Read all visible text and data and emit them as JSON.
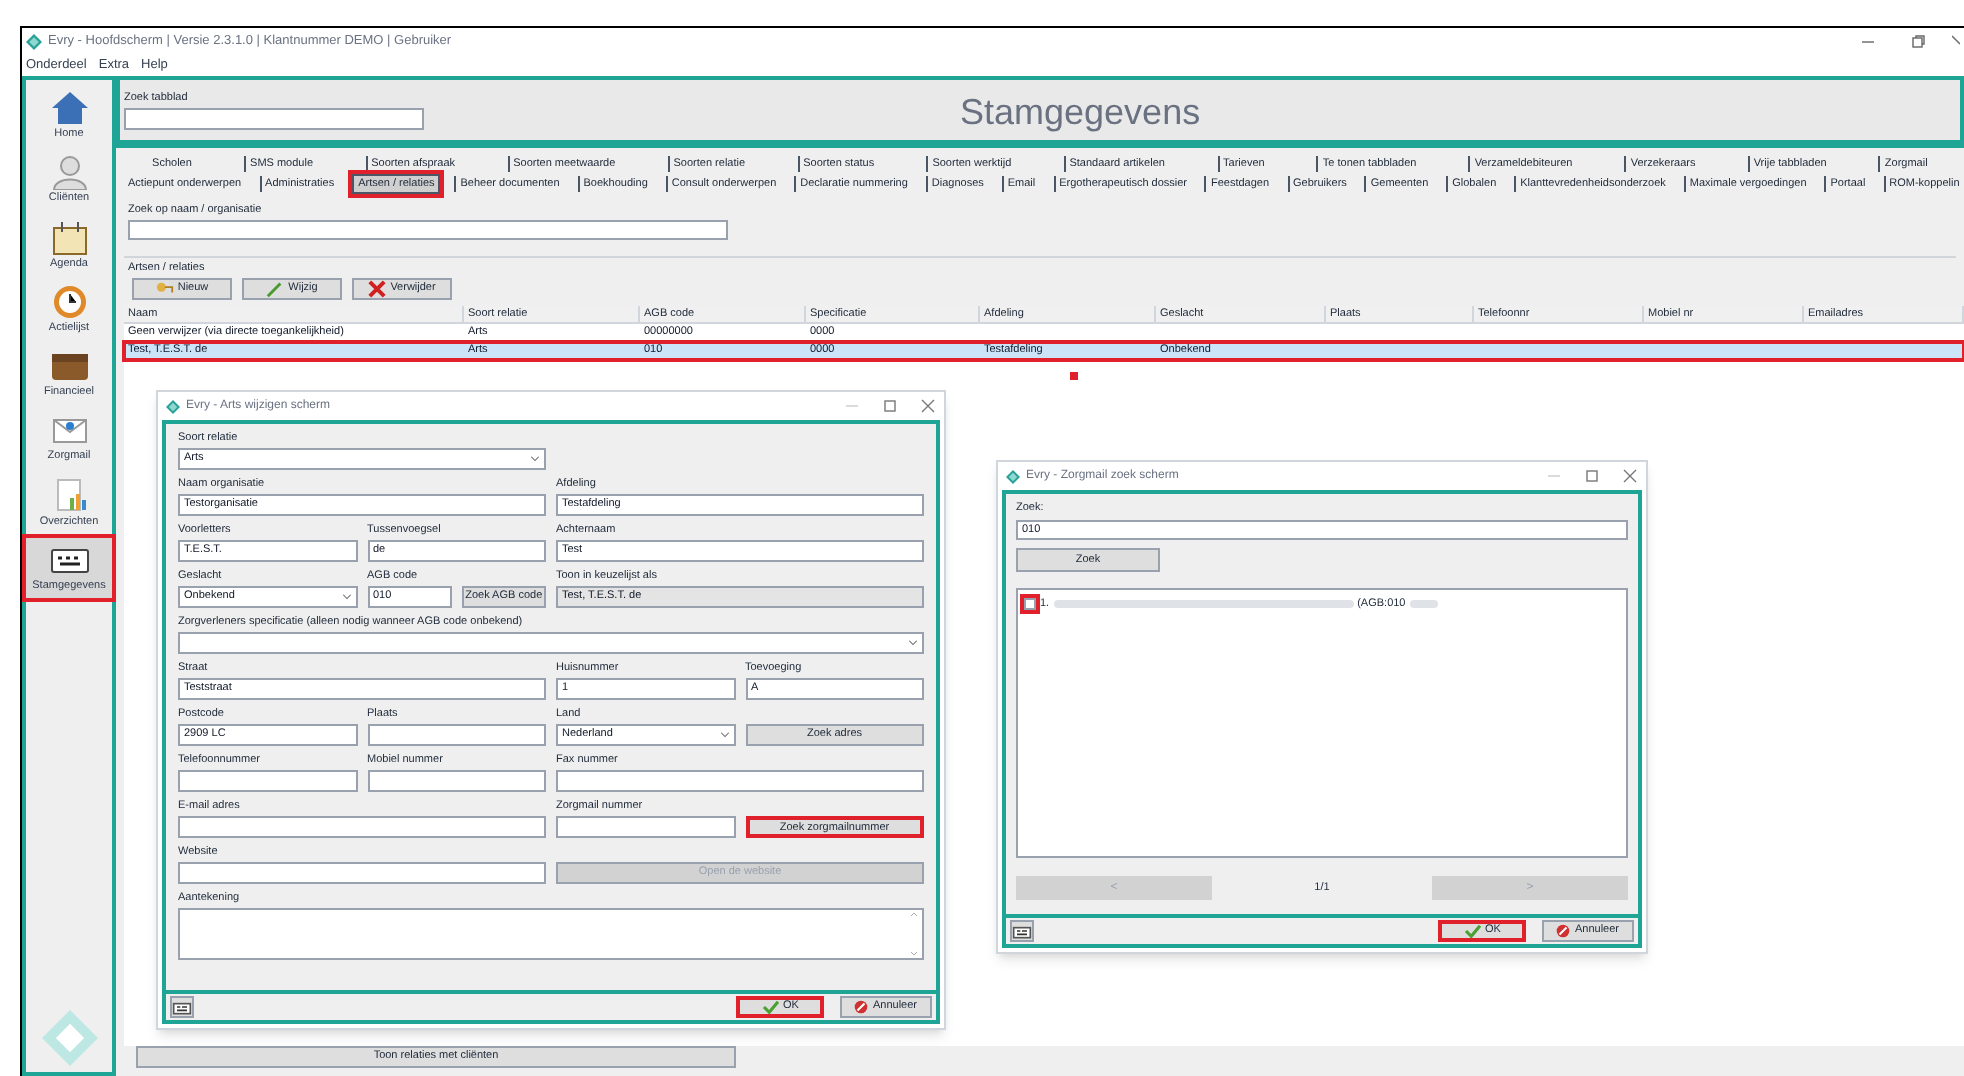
{
  "window": {
    "title": "Evry - Hoofdscherm | Versie 2.3.1.0 | Klantnummer DEMO | Gebruiker"
  },
  "menu": [
    "Onderdeel",
    "Extra",
    "Help"
  ],
  "sidebar": {
    "items": [
      {
        "label": "Home",
        "selected": false,
        "highlighted": false
      },
      {
        "label": "Cliënten",
        "selected": false,
        "highlighted": false
      },
      {
        "label": "Agenda",
        "selected": false,
        "highlighted": false
      },
      {
        "label": "Actielijst",
        "selected": false,
        "highlighted": false
      },
      {
        "label": "Financieel",
        "selected": false,
        "highlighted": false
      },
      {
        "label": "Zorgmail",
        "selected": false,
        "highlighted": false
      },
      {
        "label": "Overzichten",
        "selected": false,
        "highlighted": false
      },
      {
        "label": "Stamgegevens",
        "selected": true,
        "highlighted": true
      }
    ]
  },
  "header": {
    "search_label": "Zoek tabblad",
    "title": "Stamgegevens"
  },
  "tab_rows": [
    [
      {
        "label": "Scholen",
        "selected": false,
        "highlighted": false
      },
      {
        "label": "SMS module",
        "selected": false,
        "highlighted": false
      },
      {
        "label": "Soorten afspraak",
        "selected": false,
        "highlighted": false
      },
      {
        "label": "Soorten meetwaarde",
        "selected": false,
        "highlighted": false
      },
      {
        "label": "Soorten relatie",
        "selected": false,
        "highlighted": false
      },
      {
        "label": "Soorten status",
        "selected": false,
        "highlighted": false
      },
      {
        "label": "Soorten werktijd",
        "selected": false,
        "highlighted": false
      },
      {
        "label": "Standaard artikelen",
        "selected": false,
        "highlighted": false
      },
      {
        "label": "Tarieven",
        "selected": false,
        "highlighted": false
      },
      {
        "label": "Te tonen tabbladen",
        "selected": false,
        "highlighted": false
      },
      {
        "label": "Verzameldebiteuren",
        "selected": false,
        "highlighted": false
      },
      {
        "label": "Verzekeraars",
        "selected": false,
        "highlighted": false
      },
      {
        "label": "Vrije tabbladen",
        "selected": false,
        "highlighted": false
      },
      {
        "label": "Zorgmail",
        "selected": false,
        "highlighted": false
      }
    ],
    [
      {
        "label": "Actiepunt onderwerpen",
        "selected": false,
        "highlighted": false
      },
      {
        "label": "Administraties",
        "selected": false,
        "highlighted": false
      },
      {
        "label": "Artsen / relaties",
        "selected": true,
        "highlighted": true
      },
      {
        "label": "Beheer documenten",
        "selected": false,
        "highlighted": false
      },
      {
        "label": "Boekhouding",
        "selected": false,
        "highlighted": false
      },
      {
        "label": "Consult onderwerpen",
        "selected": false,
        "highlighted": false
      },
      {
        "label": "Declaratie nummering",
        "selected": false,
        "highlighted": false
      },
      {
        "label": "Diagnoses",
        "selected": false,
        "highlighted": false
      },
      {
        "label": "Email",
        "selected": false,
        "highlighted": false
      },
      {
        "label": "Ergotherapeutisch dossier",
        "selected": false,
        "highlighted": false
      },
      {
        "label": "Feestdagen",
        "selected": false,
        "highlighted": false
      },
      {
        "label": "Gebruikers",
        "selected": false,
        "highlighted": false
      },
      {
        "label": "Gemeenten",
        "selected": false,
        "highlighted": false
      },
      {
        "label": "Globalen",
        "selected": false,
        "highlighted": false
      },
      {
        "label": "Klanttevredenheidsonderzoek",
        "selected": false,
        "highlighted": false
      },
      {
        "label": "Maximale vergoedingen",
        "selected": false,
        "highlighted": false
      },
      {
        "label": "Portaal",
        "selected": false,
        "highlighted": false
      },
      {
        "label": "ROM-koppelin",
        "selected": false,
        "highlighted": false
      }
    ]
  ],
  "name_search": {
    "label": "Zoek op naam / organisatie"
  },
  "group": {
    "title": "Artsen / relaties",
    "buttons": [
      "Nieuw",
      "Wijzig",
      "Verwijder"
    ]
  },
  "table": {
    "columns": [
      "Naam",
      "Soort relatie",
      "AGB code",
      "Specificatie",
      "Afdeling",
      "Geslacht",
      "Plaats",
      "Telefoonnr",
      "Mobiel nr",
      "Emailadres"
    ],
    "rows": [
      {
        "cells": [
          "Geen verwijzer (via directe toegankelijkheid)",
          "Arts",
          "00000000",
          "0000",
          null,
          null,
          null,
          null,
          null,
          null
        ],
        "selected": false,
        "highlighted": false
      },
      {
        "cells": [
          "Test, T.E.S.T. de",
          "Arts",
          "010",
          "0000",
          "Testafdeling",
          "Onbekend",
          null,
          null,
          null,
          null
        ],
        "selected": true,
        "highlighted": true
      }
    ]
  },
  "bottom_button": "Toon relaties met cliënten",
  "arts_dialog": {
    "title": "Evry - Arts wijzigen scherm",
    "fields": [
      {
        "kind": "select",
        "label": "Soort relatie",
        "value": "Arts"
      },
      {
        "kind": "text",
        "label": "Naam organisatie",
        "value": "Testorganisatie"
      },
      {
        "kind": "text",
        "label": "Afdeling",
        "value": "Testafdeling"
      },
      {
        "kind": "text",
        "label": "Voorletters",
        "value": "T.E.S.T."
      },
      {
        "kind": "text",
        "label": "Tussenvoegsel",
        "value": "de"
      },
      {
        "kind": "text",
        "label": "Achternaam",
        "value": "Test"
      },
      {
        "kind": "select",
        "label": "Geslacht",
        "value": "Onbekend"
      },
      {
        "kind": "text",
        "label": "AGB code",
        "value": "010"
      },
      {
        "kind": "button",
        "label": "Zoek AGB code",
        "disabled": false,
        "highlighted": false
      },
      {
        "kind": "readonly",
        "label": "Toon in keuzelijst als",
        "value": "Test, T.E.S.T. de"
      },
      {
        "kind": "select",
        "label": "Zorgverleners specificatie (alleen nodig wanneer AGB code onbekend)"
      },
      {
        "kind": "text",
        "label": "Straat",
        "value": "Teststraat"
      },
      {
        "kind": "text",
        "label": "Huisnummer",
        "value": "1"
      },
      {
        "kind": "text",
        "label": "Toevoeging",
        "value": "A"
      },
      {
        "kind": "text",
        "label": "Postcode",
        "value": "2909 LC"
      },
      {
        "kind": "text",
        "label": "Plaats"
      },
      {
        "kind": "select",
        "label": "Land",
        "value": "Nederland"
      },
      {
        "kind": "button",
        "label": "Zoek adres",
        "disabled": false,
        "highlighted": false
      },
      {
        "kind": "text",
        "label": "Telefoonnummer"
      },
      {
        "kind": "text",
        "label": "Mobiel nummer"
      },
      {
        "kind": "text",
        "label": "Fax nummer"
      },
      {
        "kind": "text",
        "label": "E-mail adres"
      },
      {
        "kind": "text",
        "label": "Zorgmail nummer"
      },
      {
        "kind": "button",
        "label": "Zoek zorgmailnummer",
        "disabled": false,
        "highlighted": true
      },
      {
        "kind": "text",
        "label": "Website"
      },
      {
        "kind": "button",
        "label": "Open de website",
        "disabled": true,
        "highlighted": false
      },
      {
        "kind": "textarea",
        "label": "Aantekening"
      }
    ],
    "ok": {
      "label": "OK",
      "highlighted": true
    },
    "cancel": {
      "label": "Annuleer",
      "highlighted": false
    }
  },
  "zorgmail_dialog": {
    "title": "Evry - Zorgmail zoek scherm",
    "search_label": "Zoek:",
    "search_value": "010",
    "search_button": "Zoek",
    "results": [
      {
        "number": "1.",
        "text": "(AGB:010",
        "checked": false,
        "highlighted": true
      }
    ],
    "prev": "<",
    "page": "1/1",
    "next": ">",
    "ok": {
      "label": "OK",
      "highlighted": true
    },
    "cancel": {
      "label": "Annuleer",
      "highlighted": false
    }
  }
}
